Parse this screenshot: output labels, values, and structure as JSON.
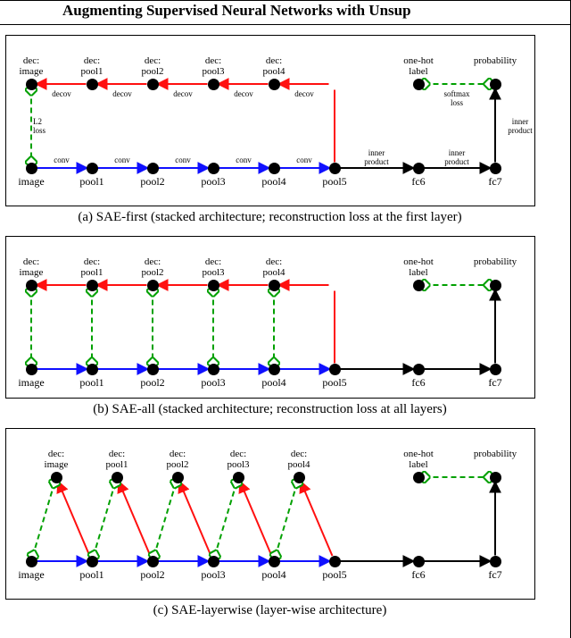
{
  "title": "Augmenting Supervised Neural Networks with Unsup",
  "geom": {
    "figWidth": 592,
    "xBottom": [
      28,
      96,
      164,
      232,
      300,
      368,
      462,
      548
    ],
    "xTop": [
      28,
      96,
      164,
      232,
      300,
      462,
      548
    ],
    "a": {
      "height": 190,
      "yTop": 54,
      "yBottom": 148
    },
    "b": {
      "height": 180,
      "yTop": 54,
      "yBottom": 148
    },
    "c": {
      "height": 190,
      "yTop": 54,
      "yBottom": 148,
      "slant": 28
    }
  },
  "bottomRowLabels": [
    "image",
    "pool1",
    "pool2",
    "pool3",
    "pool4",
    "pool5",
    "fc6",
    "fc7"
  ],
  "topRowLabels": [
    "dec:\nimage",
    "dec:\npool1",
    "dec:\npool2",
    "dec:\npool3",
    "dec:\npool4",
    "one-hot\nlabel",
    "probability"
  ],
  "edgeLabels": {
    "conv": "conv",
    "decov": "decov",
    "inner": "inner\nproduct",
    "softmax": "softmax\nloss",
    "l2": "L2\nloss"
  },
  "captions": {
    "a": "(a) SAE-first (stacked architecture; reconstruction loss at the first layer)",
    "b": "(b) SAE-all (stacked architecture; reconstruction loss at all layers)",
    "c": "(c) SAE-layerwise (layer-wise architecture)"
  },
  "chart_data": [
    {
      "id": "a",
      "type": "diagram",
      "title": "SAE-first",
      "bottom_nodes": [
        "image",
        "pool1",
        "pool2",
        "pool3",
        "pool4",
        "pool5",
        "fc6",
        "fc7"
      ],
      "top_nodes": [
        "dec:image",
        "dec:pool1",
        "dec:pool2",
        "dec:pool3",
        "dec:pool4",
        "one-hot label",
        "probability"
      ],
      "forward_edges": [
        [
          "image",
          "pool1",
          "conv",
          "blue"
        ],
        [
          "pool1",
          "pool2",
          "conv",
          "blue"
        ],
        [
          "pool2",
          "pool3",
          "conv",
          "blue"
        ],
        [
          "pool3",
          "pool4",
          "conv",
          "blue"
        ],
        [
          "pool4",
          "pool5",
          "conv",
          "blue"
        ],
        [
          "pool5",
          "fc6",
          "inner product",
          "black"
        ],
        [
          "fc6",
          "fc7",
          "inner product",
          "black"
        ],
        [
          "fc7",
          "probability",
          "inner product",
          "black",
          "vertical"
        ]
      ],
      "decoder_edges": [
        [
          "pool5",
          "dec:pool4",
          "decov",
          "red",
          "vertical"
        ],
        [
          "dec:pool4",
          "dec:pool3",
          "decov",
          "red"
        ],
        [
          "dec:pool3",
          "dec:pool2",
          "decov",
          "red"
        ],
        [
          "dec:pool2",
          "dec:pool1",
          "decov",
          "red"
        ],
        [
          "dec:pool1",
          "dec:image",
          "decov",
          "red"
        ]
      ],
      "loss_edges": [
        [
          "dec:image",
          "image",
          "L2 loss",
          "green"
        ],
        [
          "one-hot label",
          "probability",
          "softmax loss",
          "green"
        ]
      ]
    },
    {
      "id": "b",
      "type": "diagram",
      "title": "SAE-all",
      "bottom_nodes": [
        "image",
        "pool1",
        "pool2",
        "pool3",
        "pool4",
        "pool5",
        "fc6",
        "fc7"
      ],
      "top_nodes": [
        "dec:image",
        "dec:pool1",
        "dec:pool2",
        "dec:pool3",
        "dec:pool4",
        "one-hot label",
        "probability"
      ],
      "forward_edges": [
        [
          "image",
          "pool1",
          "",
          "blue"
        ],
        [
          "pool1",
          "pool2",
          "",
          "blue"
        ],
        [
          "pool2",
          "pool3",
          "",
          "blue"
        ],
        [
          "pool3",
          "pool4",
          "",
          "blue"
        ],
        [
          "pool4",
          "pool5",
          "",
          "blue"
        ],
        [
          "pool5",
          "fc6",
          "",
          "black"
        ],
        [
          "fc6",
          "fc7",
          "",
          "black"
        ],
        [
          "fc7",
          "probability",
          "",
          "black",
          "vertical"
        ]
      ],
      "decoder_edges": [
        [
          "pool5",
          "dec:pool4",
          "",
          "red",
          "vertical"
        ],
        [
          "dec:pool4",
          "dec:pool3",
          "",
          "red"
        ],
        [
          "dec:pool3",
          "dec:pool2",
          "",
          "red"
        ],
        [
          "dec:pool2",
          "dec:pool1",
          "",
          "red"
        ],
        [
          "dec:pool1",
          "dec:image",
          "",
          "red"
        ]
      ],
      "loss_edges": [
        [
          "dec:image",
          "image",
          "",
          "green"
        ],
        [
          "dec:pool1",
          "pool1",
          "",
          "green"
        ],
        [
          "dec:pool2",
          "pool2",
          "",
          "green"
        ],
        [
          "dec:pool3",
          "pool3",
          "",
          "green"
        ],
        [
          "dec:pool4",
          "pool4",
          "",
          "green"
        ],
        [
          "one-hot label",
          "probability",
          "",
          "green"
        ]
      ]
    },
    {
      "id": "c",
      "type": "diagram",
      "title": "SAE-layerwise",
      "bottom_nodes": [
        "image",
        "pool1",
        "pool2",
        "pool3",
        "pool4",
        "pool5",
        "fc6",
        "fc7"
      ],
      "top_nodes": [
        "dec:image",
        "dec:pool1",
        "dec:pool2",
        "dec:pool3",
        "dec:pool4",
        "one-hot label",
        "probability"
      ],
      "forward_edges": [
        [
          "image",
          "pool1",
          "",
          "blue"
        ],
        [
          "pool1",
          "pool2",
          "",
          "blue"
        ],
        [
          "pool2",
          "pool3",
          "",
          "blue"
        ],
        [
          "pool3",
          "pool4",
          "",
          "blue"
        ],
        [
          "pool4",
          "pool5",
          "",
          "blue"
        ],
        [
          "pool5",
          "fc6",
          "",
          "black"
        ],
        [
          "fc6",
          "fc7",
          "",
          "black"
        ],
        [
          "fc7",
          "probability",
          "",
          "black",
          "vertical"
        ]
      ],
      "decoder_edges": [
        [
          "pool1",
          "dec:image",
          "",
          "red",
          "diag"
        ],
        [
          "pool2",
          "dec:pool1",
          "",
          "red",
          "diag"
        ],
        [
          "pool3",
          "dec:pool2",
          "",
          "red",
          "diag"
        ],
        [
          "pool4",
          "dec:pool3",
          "",
          "red",
          "diag"
        ],
        [
          "pool5",
          "dec:pool4",
          "",
          "red",
          "diag"
        ]
      ],
      "loss_edges": [
        [
          "dec:image",
          "image",
          "",
          "green"
        ],
        [
          "dec:pool1",
          "pool1",
          "",
          "green"
        ],
        [
          "dec:pool2",
          "pool2",
          "",
          "green"
        ],
        [
          "dec:pool3",
          "pool3",
          "",
          "green"
        ],
        [
          "dec:pool4",
          "pool4",
          "",
          "green"
        ],
        [
          "one-hot label",
          "probability",
          "",
          "green"
        ]
      ]
    }
  ]
}
